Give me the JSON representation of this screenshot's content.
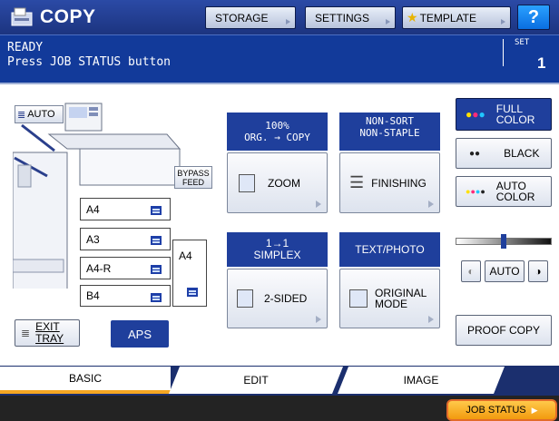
{
  "header": {
    "title": "COPY",
    "buttons": {
      "storage": "STORAGE",
      "settings": "SETTINGS",
      "template": "TEMPLATE",
      "help": "?"
    }
  },
  "status": {
    "line1": "READY",
    "line2": "Press JOB STATUS button",
    "set_label": "SET",
    "set_value": "1"
  },
  "machine": {
    "auto_label": "AUTO",
    "bypass": [
      "BYPASS",
      "FEED"
    ],
    "exit_tray": [
      "EXIT",
      "TRAY"
    ],
    "aps": "APS",
    "trays": [
      "A4",
      "A3",
      "A4-R",
      "B4"
    ],
    "lcf": "A4"
  },
  "functions": {
    "zoom": {
      "header": [
        "100%",
        "ORG. → COPY"
      ],
      "label": "ZOOM"
    },
    "finishing": {
      "header": [
        "NON-SORT",
        "NON-STAPLE"
      ],
      "label": "FINISHING"
    },
    "duplex": {
      "header": [
        "1→1",
        "SIMPLEX"
      ],
      "label": "2-SIDED"
    },
    "original": {
      "header": [
        "TEXT/PHOTO"
      ],
      "label": [
        "ORIGINAL",
        "MODE"
      ]
    }
  },
  "color": {
    "full": [
      "FULL",
      "COLOR"
    ],
    "black": "BLACK",
    "auto": [
      "AUTO",
      "COLOR"
    ]
  },
  "density": {
    "auto": "AUTO",
    "level": 0.5
  },
  "proof": "PROOF COPY",
  "tabs": [
    "BASIC",
    "EDIT",
    "IMAGE"
  ],
  "job_status": "JOB STATUS",
  "colors": {
    "accent_blue": "#1f3f9c",
    "tab_orange": "#f5a623",
    "job_orange": "#f29a0e"
  }
}
